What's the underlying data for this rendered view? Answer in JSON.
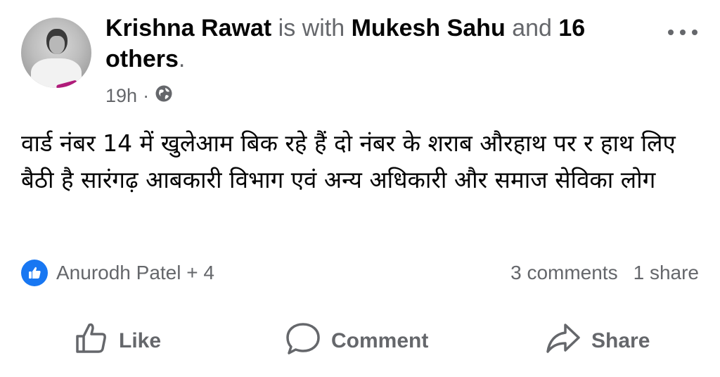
{
  "post": {
    "author": "Krishna Rawat",
    "with_text": "is with",
    "tagged": "Mukesh Sahu",
    "and_text": "and",
    "others_text": "16 others",
    "period": ".",
    "time": "19h",
    "separator": "·",
    "privacy_icon": "globe-icon",
    "message": "वार्ड नंबर 14 में खुलेआम बिक रहे हैं दो नंबर के शराब औरहाथ पर र हाथ लिए बैठी है सारंगढ़ आबकारी विभाग एवं अन्य अधिकारी और समाज सेविका लोग"
  },
  "reactions": {
    "icon": "like-icon",
    "summary": "Anurodh Patel + 4",
    "comments": "3 comments",
    "shares": "1 share"
  },
  "actions": {
    "like": "Like",
    "comment": "Comment",
    "share": "Share"
  },
  "colors": {
    "accent": "#1877f2",
    "muted_text": "#65676b",
    "primary_text": "#050505"
  }
}
